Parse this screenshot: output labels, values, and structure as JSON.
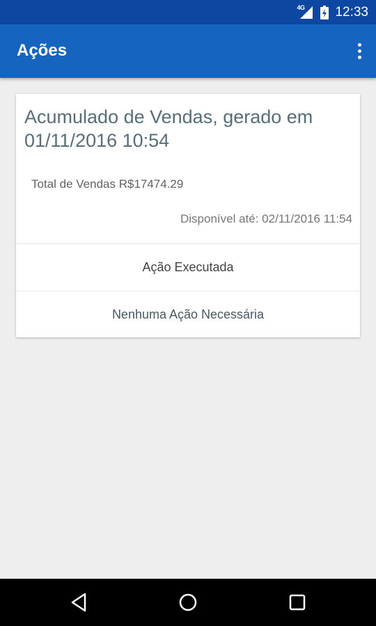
{
  "status_bar": {
    "network_label": "4G",
    "time": "12:33"
  },
  "app_bar": {
    "title": "Ações"
  },
  "card": {
    "title": "Acumulado de Vendas, gerado em 01/11/2016 10:54",
    "total": "Total de Vendas R$17474.29",
    "available_until": "Disponível até: 02/11/2016 11:54",
    "actions": [
      {
        "label": "Ação Executada"
      },
      {
        "label": "Nenhuma Ação Necessária"
      }
    ]
  },
  "colors": {
    "status_bar": "#0d47a1",
    "app_bar": "#1565c0",
    "background": "#eeeeee",
    "card_title": "#546e7a",
    "action_link": "#455a64"
  },
  "nav_bar": {
    "icons": [
      "back-icon",
      "home-icon",
      "recents-icon"
    ]
  }
}
